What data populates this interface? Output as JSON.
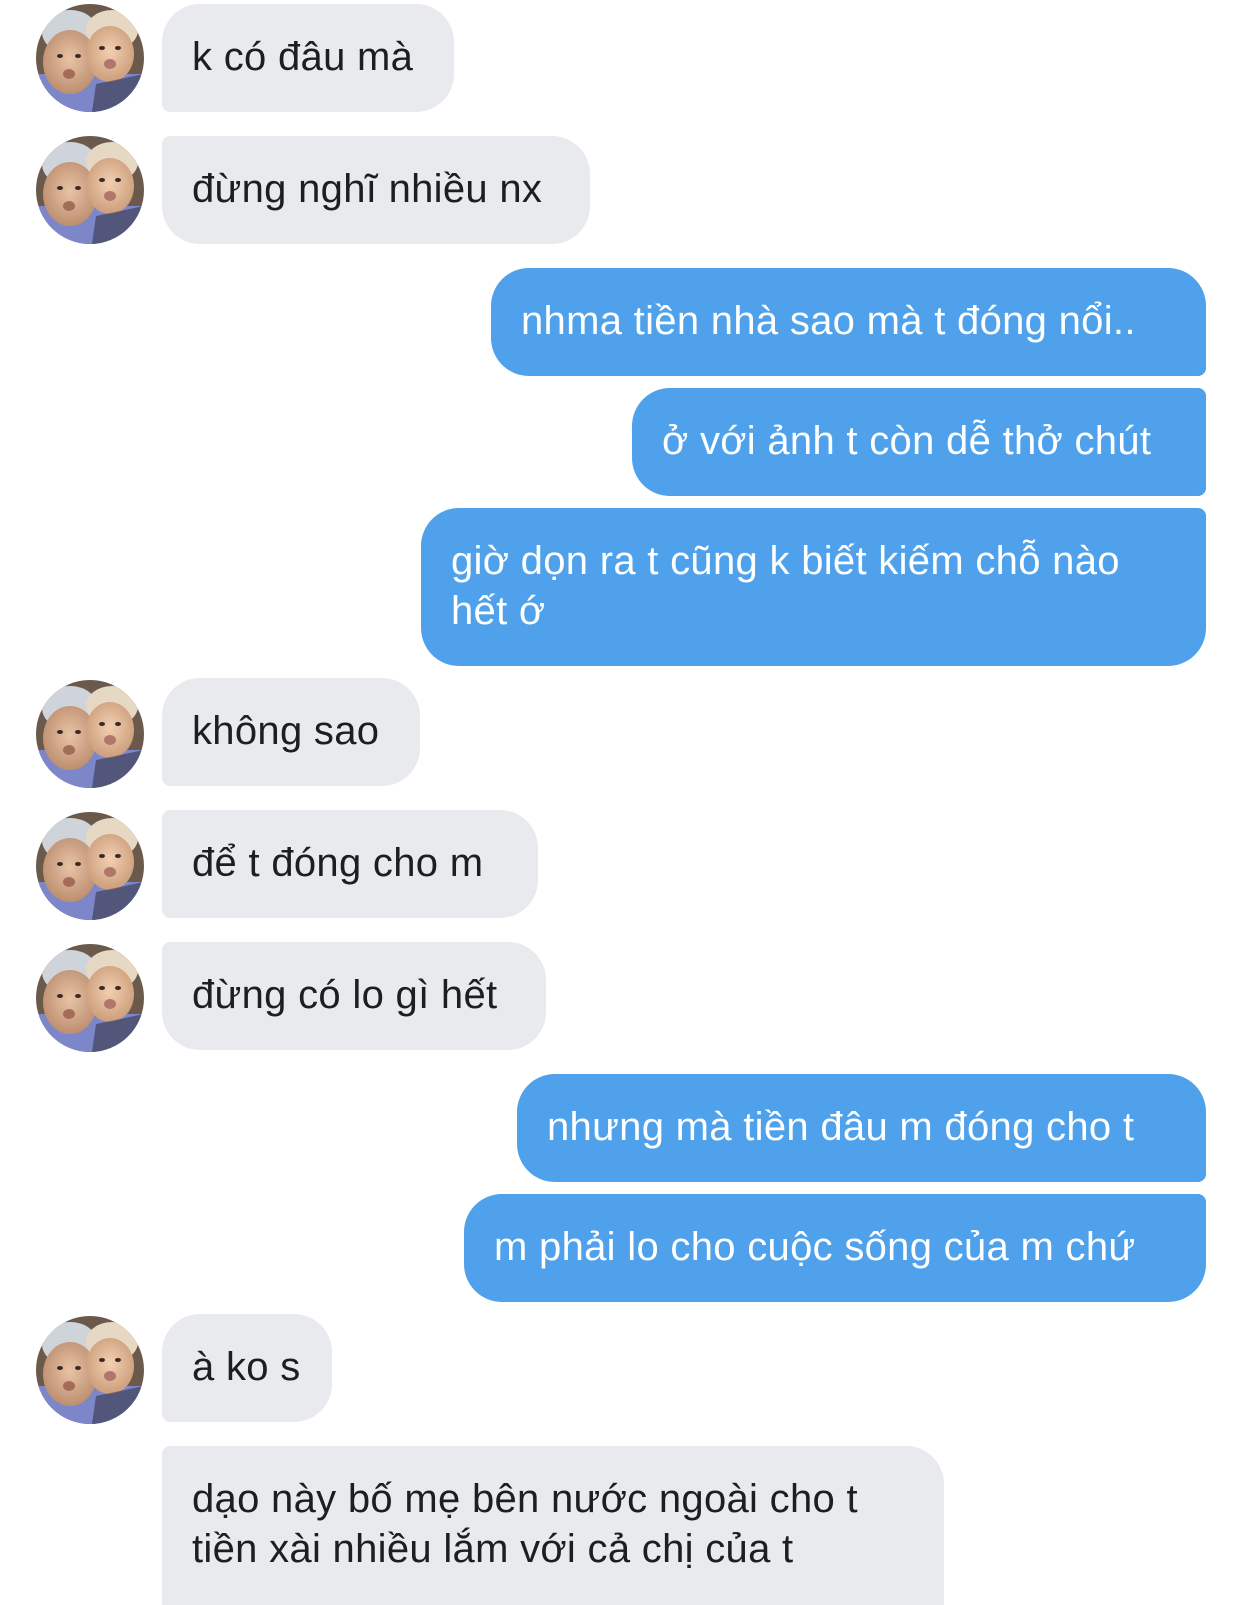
{
  "conversation": {
    "messages": [
      {
        "sender": "them",
        "text": "k có đâu mà",
        "avatar_icon": "contact-avatar"
      },
      {
        "sender": "them",
        "text": "đừng nghĩ nhiều nx",
        "avatar_icon": "contact-avatar"
      },
      {
        "sender": "me",
        "text": "nhma tiền nhà sao mà t đóng nổi.."
      },
      {
        "sender": "me",
        "text": "ở với ảnh t còn dễ thở chút"
      },
      {
        "sender": "me",
        "text": "giờ dọn ra t cũng k biết kiếm chỗ nào hết ớ"
      },
      {
        "sender": "them",
        "text": "không sao",
        "avatar_icon": "contact-avatar"
      },
      {
        "sender": "them",
        "text": "để t đóng cho m",
        "avatar_icon": "contact-avatar"
      },
      {
        "sender": "them",
        "text": "đừng có lo gì hết",
        "avatar_icon": "contact-avatar"
      },
      {
        "sender": "me",
        "text": "nhưng mà tiền đâu m đóng cho t"
      },
      {
        "sender": "me",
        "text": "m phải lo cho cuộc sống của m chứ"
      },
      {
        "sender": "them",
        "text": "à ko s",
        "avatar_icon": "contact-avatar"
      },
      {
        "sender": "them",
        "text": "dạo này bố mẹ bên nước ngoài cho t tiền xài nhiều lắm với cả chị của t"
      }
    ]
  },
  "colors": {
    "incoming_bubble": "#e9eaee",
    "outgoing_bubble": "#4ea1ea",
    "incoming_text": "#1c1e21",
    "outgoing_text": "#ffffff"
  }
}
